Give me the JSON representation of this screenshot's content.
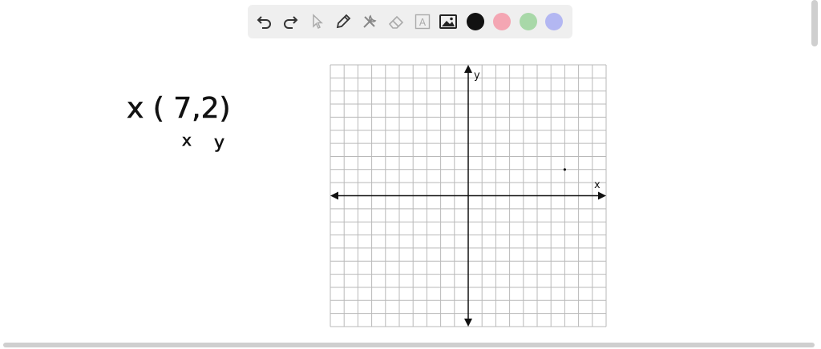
{
  "toolbar": {
    "tools": [
      {
        "name": "undo-icon"
      },
      {
        "name": "redo-icon"
      },
      {
        "name": "select-cursor-icon"
      },
      {
        "name": "pen-icon"
      },
      {
        "name": "tools-icon"
      },
      {
        "name": "eraser-icon"
      },
      {
        "name": "text-icon",
        "glyph": "A"
      },
      {
        "name": "image-icon"
      }
    ],
    "colors": [
      "#111111",
      "#f4a6b3",
      "#a8d8a8",
      "#b3b7f2"
    ]
  },
  "note": {
    "line1": "x ( 7,2)",
    "x_label": "x",
    "y_label": "y"
  },
  "graph": {
    "x_axis_label": "x",
    "y_axis_label": "y",
    "xlim": [
      -10,
      10
    ],
    "ylim": [
      -10,
      10
    ],
    "point": {
      "x": 7,
      "y": 2
    }
  }
}
